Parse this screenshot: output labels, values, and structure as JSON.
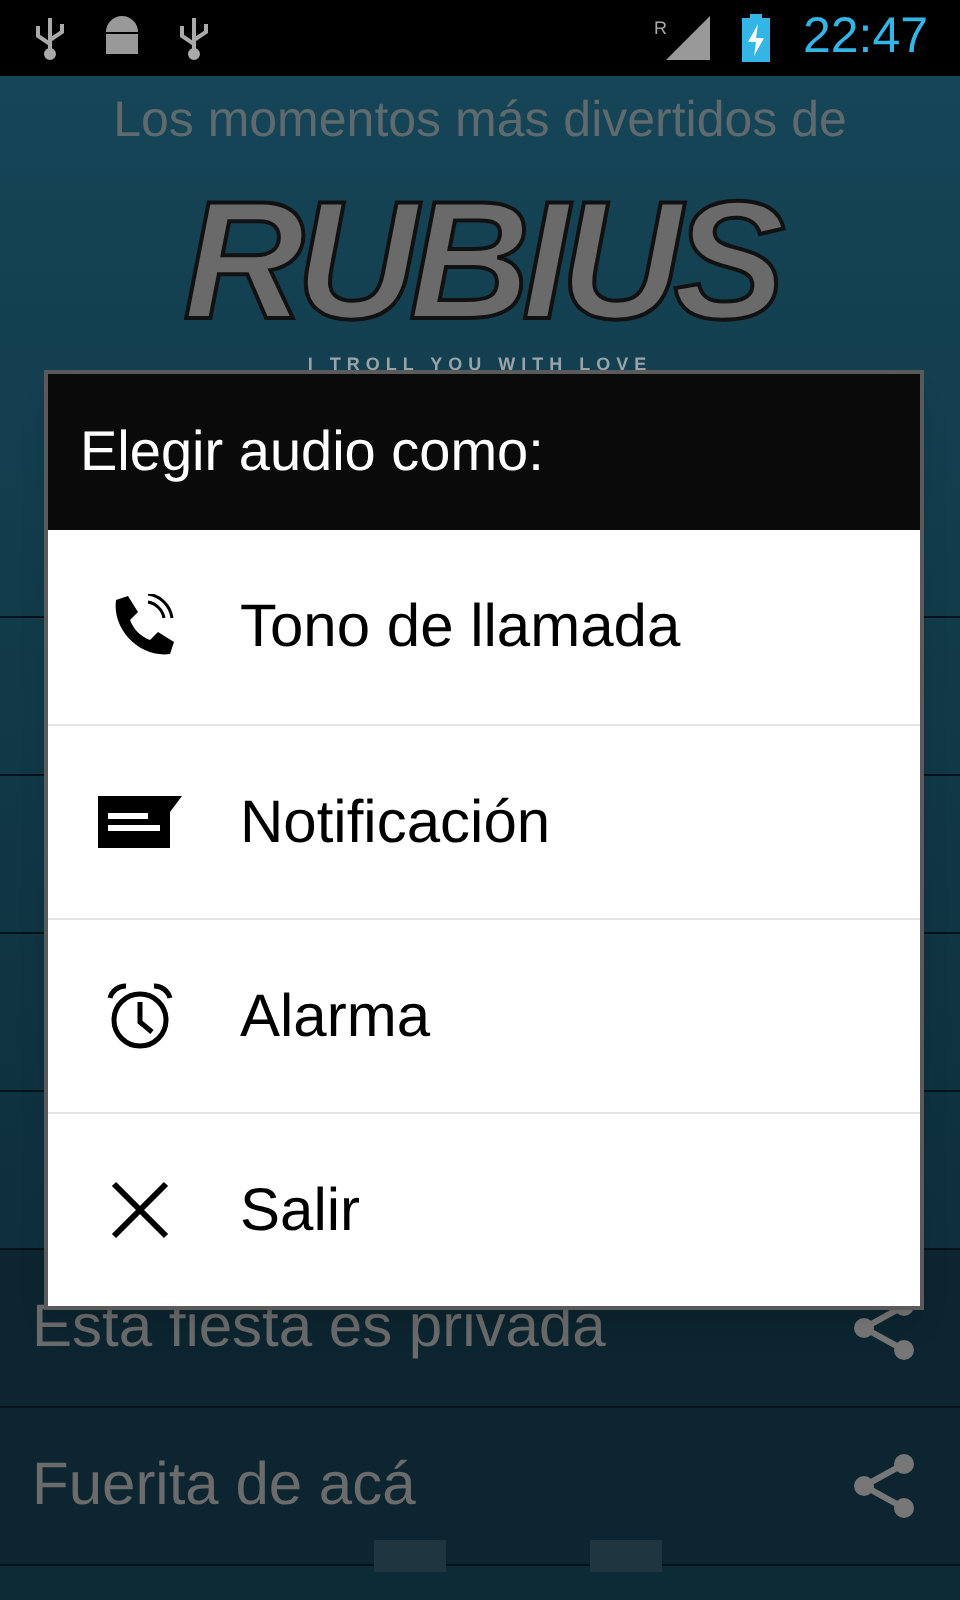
{
  "status_bar": {
    "roaming": "R",
    "time": "22:47"
  },
  "header": {
    "title": "Los momentos más divertidos de",
    "logo": "RUBIUS",
    "tagline": "I TROLL YOU WITH LOVE"
  },
  "list": [
    {
      "title": "Esta fiesta es privada"
    },
    {
      "title": "Fuerita de acá"
    }
  ],
  "dialog": {
    "title": "Elegir audio como:",
    "options": [
      {
        "kind": "ringtone",
        "label": "Tono de llamada"
      },
      {
        "kind": "notification",
        "label": "Notificación"
      },
      {
        "kind": "alarm",
        "label": "Alarma"
      },
      {
        "kind": "exit",
        "label": "Salir"
      }
    ]
  }
}
